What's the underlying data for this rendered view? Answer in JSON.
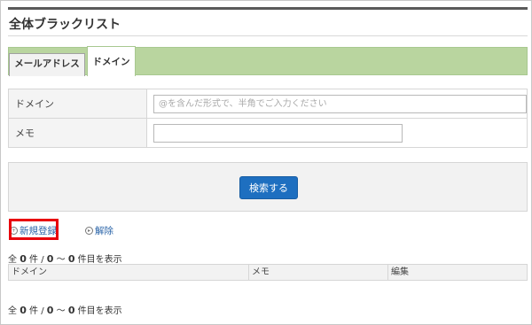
{
  "page": {
    "title": "全体ブラックリスト"
  },
  "tabs": [
    {
      "label": "メールアドレス",
      "active": false
    },
    {
      "label": "ドメイン",
      "active": true
    }
  ],
  "form": {
    "domain_label": "ドメイン",
    "domain_placeholder": "@を含んだ形式で、半角でご入力ください",
    "domain_value": "",
    "memo_label": "メモ",
    "memo_value": ""
  },
  "search": {
    "button_label": "検索する"
  },
  "actions": {
    "register_label": "新規登録",
    "register_icon": "circle-plus-icon",
    "cancel_label": "解除",
    "cancel_icon": "circle-arrow-icon"
  },
  "result": {
    "prefix": "全",
    "total": "0",
    "mid1": "件 /",
    "from": "0",
    "sep": "～",
    "to": "0",
    "suffix": "件目を表示"
  },
  "table": {
    "columns": [
      "ドメイン",
      "メモ",
      "編集"
    ]
  },
  "colors": {
    "accent_blue": "#1e6fc0",
    "tab_green": "#b9d59f",
    "highlight_red": "#e8000b",
    "link_blue": "#2a64a8"
  }
}
